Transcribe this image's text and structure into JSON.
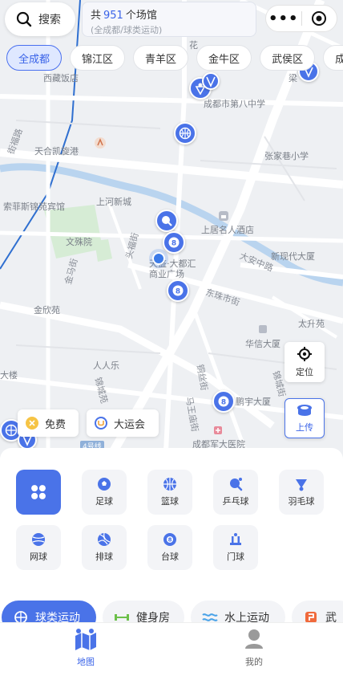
{
  "search": {
    "label": "搜索"
  },
  "venue_info": {
    "prefix": "共",
    "count": "951",
    "suffix": "个场馆",
    "filter": "(全成都/球类运动)"
  },
  "capsule": {
    "more": "•••"
  },
  "districts": [
    {
      "label": "全成都",
      "active": true
    },
    {
      "label": "锦江区"
    },
    {
      "label": "青羊区"
    },
    {
      "label": "金牛区"
    },
    {
      "label": "武侯区"
    },
    {
      "label": "成华区"
    }
  ],
  "map_labels": [
    "西藏饭店",
    "成都市第八中学",
    "天合凯旋港",
    "张家巷小学",
    "索菲斯锦苑宾馆",
    "上河新城",
    "上居名人酒店",
    "文殊院",
    "新现代大厦",
    "大安中路",
    "金欣苑",
    "天盛·大都汇商业广场",
    "东珠市街",
    "太升苑",
    "华信大厦",
    "人人乐",
    "大楼",
    "锦城苑",
    "铜丝街",
    "鹏宇大厦",
    "马王庙街",
    "成都军大医院",
    "4号线",
    "花",
    "梁",
    "街福路",
    "金马街",
    "头福街",
    "锦城街"
  ],
  "side_buttons": {
    "locate": "定位",
    "upload": "上传"
  },
  "promos": {
    "free": "免费",
    "games": "大运会"
  },
  "sports": [
    {
      "label": "全部",
      "icon": "grid-icon"
    },
    {
      "label": "足球",
      "icon": "soccer-ball-icon"
    },
    {
      "label": "篮球",
      "icon": "basketball-icon"
    },
    {
      "label": "乒乓球",
      "icon": "ping-pong-icon"
    },
    {
      "label": "羽毛球",
      "icon": "shuttlecock-icon"
    },
    {
      "label": "网球",
      "icon": "tennis-ball-icon"
    },
    {
      "label": "排球",
      "icon": "volleyball-icon"
    },
    {
      "label": "台球",
      "icon": "billiards-icon"
    },
    {
      "label": "门球",
      "icon": "gateball-icon"
    }
  ],
  "categories": [
    {
      "label": "球类运动",
      "active": true
    },
    {
      "label": "健身房"
    },
    {
      "label": "水上运动"
    },
    {
      "label": "武"
    }
  ],
  "tabs": [
    {
      "label": "地图",
      "active": true
    },
    {
      "label": "我的"
    }
  ],
  "colors": {
    "accent": "#4a73e8",
    "river": "#b9d4ef",
    "park": "#d6ecd5",
    "road": "#ffffff"
  }
}
